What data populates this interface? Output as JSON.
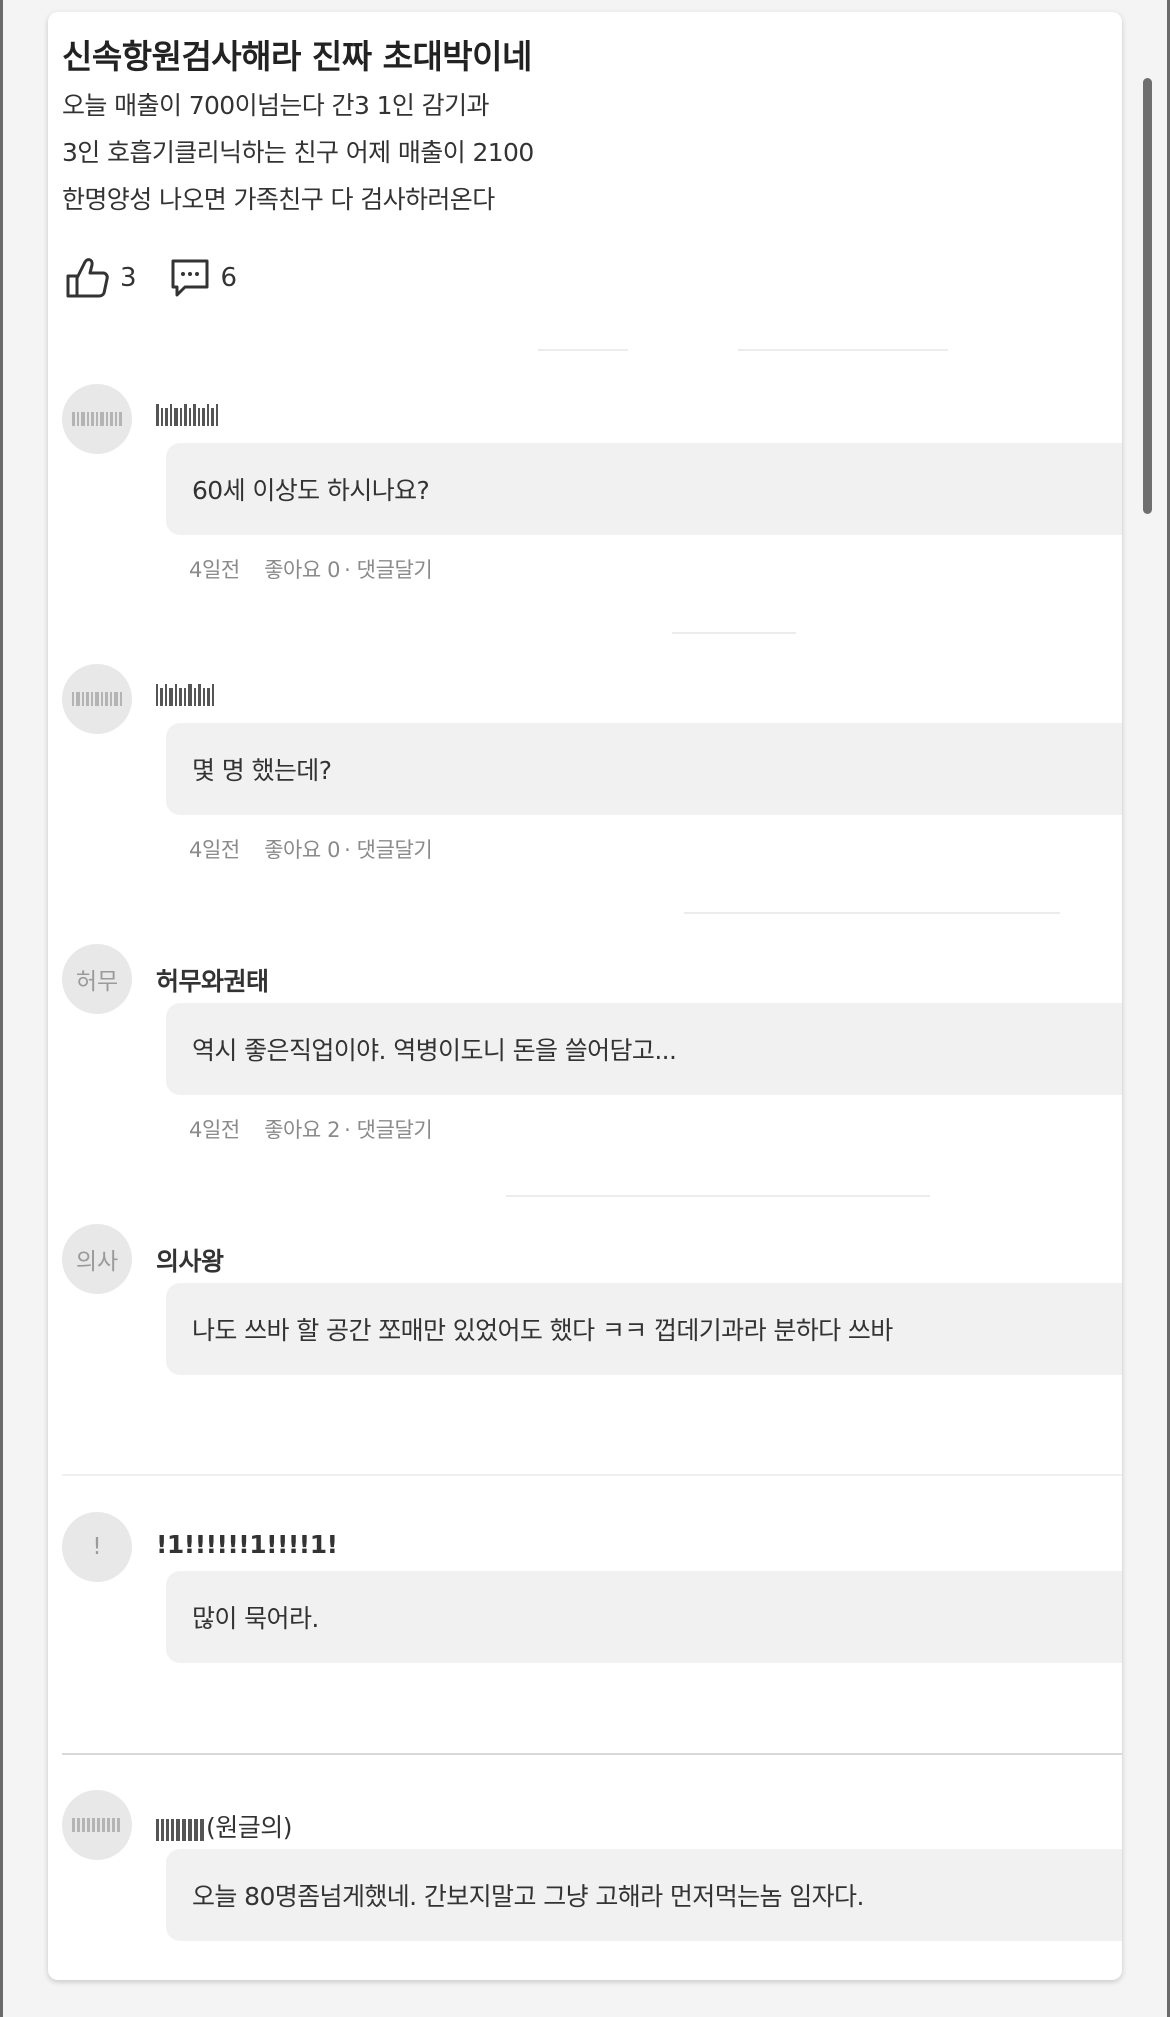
{
  "post": {
    "title": "신속항원검사해라 진짜 초대박이네",
    "body_lines": [
      "오늘 매출이 700이넘는다 간3 1인 감기과",
      "3인 호흡기클리닉하는 친구 어제 매출이 2100",
      "한명양성 나오면 가족친구 다 검사하러온다"
    ],
    "like_count": "3",
    "comment_count": "6",
    "like_icon": "thumbs-up-icon",
    "comment_icon": "speech-bubble-icon"
  },
  "comments": [
    {
      "avatar": "",
      "username": "",
      "text": "60세 이상도 하시나요?",
      "time": "4일전",
      "likes": "좋아요 0",
      "reply": "댓글달기"
    },
    {
      "avatar": "",
      "username": "",
      "text": "몇 명 했는데?",
      "time": "4일전",
      "likes": "좋아요 0",
      "reply": "댓글달기"
    },
    {
      "avatar": "허무",
      "username": "허무와권태",
      "text": "역시 좋은직업이야. 역병이도니 돈을 쓸어담고...",
      "time": "4일전",
      "likes": "좋아요 2",
      "reply": "댓글달기"
    },
    {
      "avatar": "의사",
      "username": "의사왕",
      "text": "나도 쓰바 할 공간 쪼매만 있었어도 했다 ㅋㅋ 껍데기과라 분하다 쓰바",
      "time": "",
      "likes": "",
      "reply": ""
    },
    {
      "avatar": "!",
      "username": "!1!!!!!!1!!!!1!",
      "text": "많이 묵어라.",
      "time": "",
      "likes": "",
      "reply": ""
    },
    {
      "avatar": "",
      "username": "(원글의)",
      "text": "오늘 80명좀넘게했네. 간보지말고 그냥 고해라 먼저먹는놈 임자다.",
      "time": "",
      "likes": "",
      "reply": ""
    }
  ],
  "colors": {
    "card_bg": "#ffffff",
    "bubble_bg": "#f1f1f1",
    "page_bg": "#f4f4f4",
    "meta_text": "#8a8a8a"
  }
}
